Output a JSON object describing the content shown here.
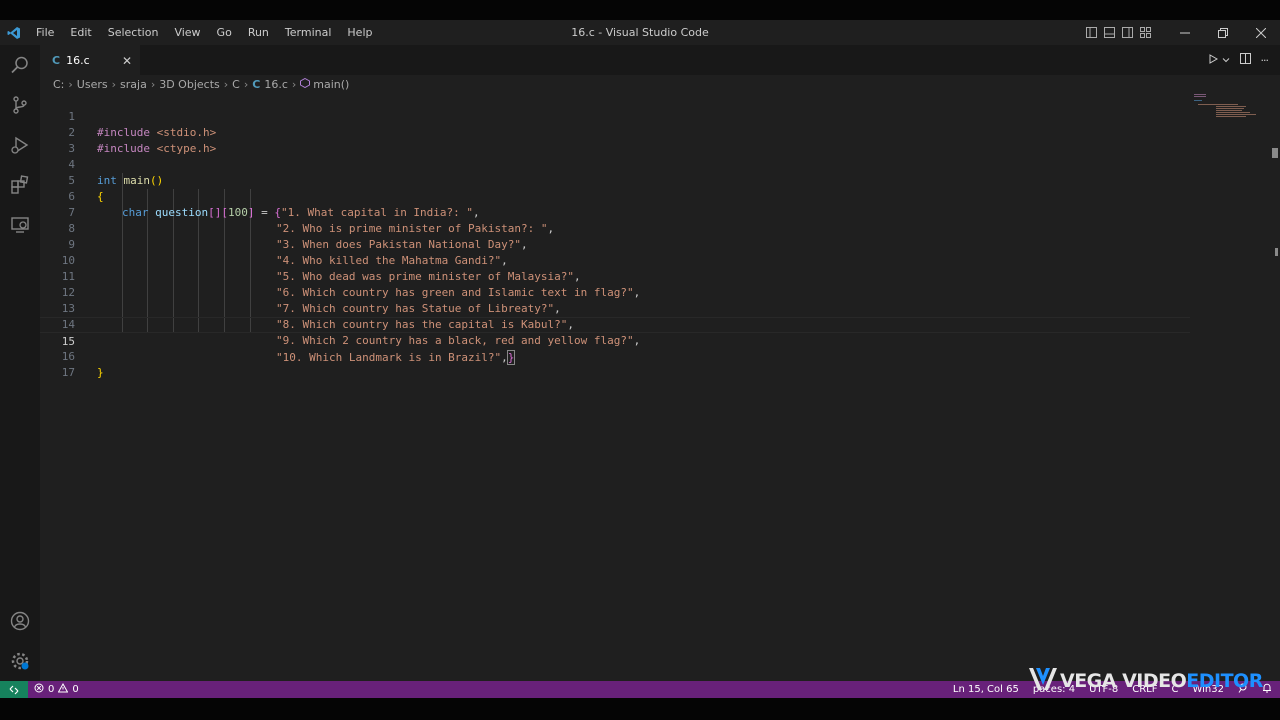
{
  "window": {
    "title": "16.c - Visual Studio Code"
  },
  "menu": [
    "File",
    "Edit",
    "Selection",
    "View",
    "Go",
    "Run",
    "Terminal",
    "Help"
  ],
  "tab": {
    "label": "16.c",
    "lang_letter": "C"
  },
  "breadcrumb": {
    "items": [
      "C:",
      "Users",
      "sraja",
      "3D Objects",
      "C"
    ],
    "file_letter": "C",
    "file": "16.c",
    "symbol": "main()"
  },
  "code": {
    "current_line": 15,
    "lines": [
      {
        "n": "1"
      },
      {
        "n": "2"
      },
      {
        "n": "3"
      },
      {
        "n": "4"
      },
      {
        "n": "5"
      },
      {
        "n": "6"
      },
      {
        "n": "7"
      },
      {
        "n": "8"
      },
      {
        "n": "9"
      },
      {
        "n": "10"
      },
      {
        "n": "11"
      },
      {
        "n": "12"
      },
      {
        "n": "13"
      },
      {
        "n": "14"
      },
      {
        "n": "15"
      },
      {
        "n": "16"
      },
      {
        "n": "17"
      }
    ],
    "include1": {
      "directive": "#include",
      "header": "<stdio.h>"
    },
    "include2": {
      "directive": "#include",
      "header": "<ctype.h>"
    },
    "main_type": "int",
    "main_name": "main",
    "main_parens": "()",
    "brace_open": "{",
    "brace_close": "}",
    "decl_type": "char",
    "decl_var": "question",
    "decl_dims_a": "[]",
    "decl_dims_b_open": "[",
    "decl_dims_num": "100",
    "decl_dims_b_close": "]",
    "decl_eq": " = ",
    "init_open": "{",
    "init_close": "}",
    "strings": [
      "\"1. What capital in India?: \"",
      "\"2. Who is prime minister of Pakistan?: \"",
      "\"3. When does Pakistan National Day?\"",
      "\"4. Who killed the Mahatma Gandi?\"",
      "\"5. Who dead was prime minister of Malaysia?\"",
      "\"6. Which country has green and Islamic text in flag?\"",
      "\"7. Which country has Statue of Libreaty?\"",
      "\"8. Which country has the capital is Kabul?\"",
      "\"9. Which 2 country has a black, red and yellow flag?\"",
      "\"10. Which Landmark is in Brazil?\""
    ],
    "comma": ","
  },
  "status": {
    "errors": "0",
    "warnings": "0",
    "position": "Ln 15, Col 65",
    "spaces": "paces: 4",
    "encoding": "UTF-8",
    "eol": "CRLF",
    "language": "C",
    "platform": "Win32"
  },
  "watermark": {
    "part1": "VEGA VIDEO ",
    "part2": "EDITOR"
  },
  "colors": {
    "status_bg": "#68217a",
    "remote_bg": "#16825d",
    "editor_bg": "#1f1f1f"
  }
}
